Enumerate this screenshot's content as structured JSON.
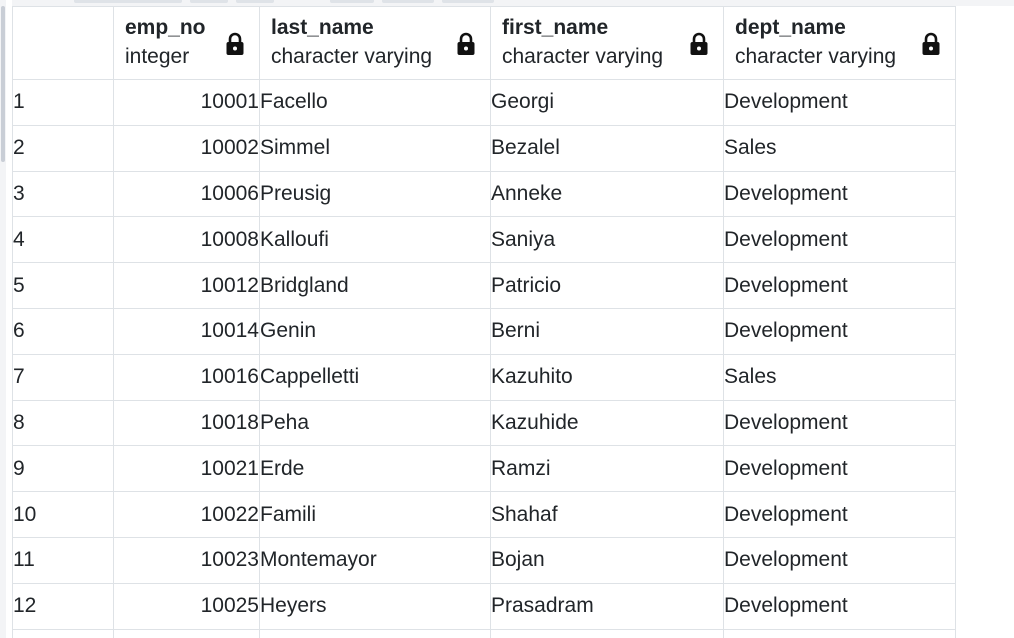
{
  "table": {
    "columns": [
      {
        "name": "",
        "type": ""
      },
      {
        "name": "emp_no",
        "type": "integer",
        "icon": "lock-icon"
      },
      {
        "name": "last_name",
        "type": "character varying",
        "icon": "lock-icon"
      },
      {
        "name": "first_name",
        "type": "character varying",
        "icon": "lock-icon"
      },
      {
        "name": "dept_name",
        "type": "character varying",
        "icon": "lock-icon"
      }
    ],
    "rows": [
      {
        "n": "1",
        "emp_no": "10001",
        "last_name": "Facello",
        "first_name": "Georgi",
        "dept_name": "Development"
      },
      {
        "n": "2",
        "emp_no": "10002",
        "last_name": "Simmel",
        "first_name": "Bezalel",
        "dept_name": "Sales"
      },
      {
        "n": "3",
        "emp_no": "10006",
        "last_name": "Preusig",
        "first_name": "Anneke",
        "dept_name": "Development"
      },
      {
        "n": "4",
        "emp_no": "10008",
        "last_name": "Kalloufi",
        "first_name": "Saniya",
        "dept_name": "Development"
      },
      {
        "n": "5",
        "emp_no": "10012",
        "last_name": "Bridgland",
        "first_name": "Patricio",
        "dept_name": "Development"
      },
      {
        "n": "6",
        "emp_no": "10014",
        "last_name": "Genin",
        "first_name": "Berni",
        "dept_name": "Development"
      },
      {
        "n": "7",
        "emp_no": "10016",
        "last_name": "Cappelletti",
        "first_name": "Kazuhito",
        "dept_name": "Sales"
      },
      {
        "n": "8",
        "emp_no": "10018",
        "last_name": "Peha",
        "first_name": "Kazuhide",
        "dept_name": "Development"
      },
      {
        "n": "9",
        "emp_no": "10021",
        "last_name": "Erde",
        "first_name": "Ramzi",
        "dept_name": "Development"
      },
      {
        "n": "10",
        "emp_no": "10022",
        "last_name": "Famili",
        "first_name": "Shahaf",
        "dept_name": "Development"
      },
      {
        "n": "11",
        "emp_no": "10023",
        "last_name": "Montemayor",
        "first_name": "Bojan",
        "dept_name": "Development"
      },
      {
        "n": "12",
        "emp_no": "10025",
        "last_name": "Heyers",
        "first_name": "Prasadram",
        "dept_name": "Development"
      }
    ]
  },
  "colors": {
    "grid_border": "#dee2e6",
    "text": "#212529",
    "background": "#ffffff"
  }
}
